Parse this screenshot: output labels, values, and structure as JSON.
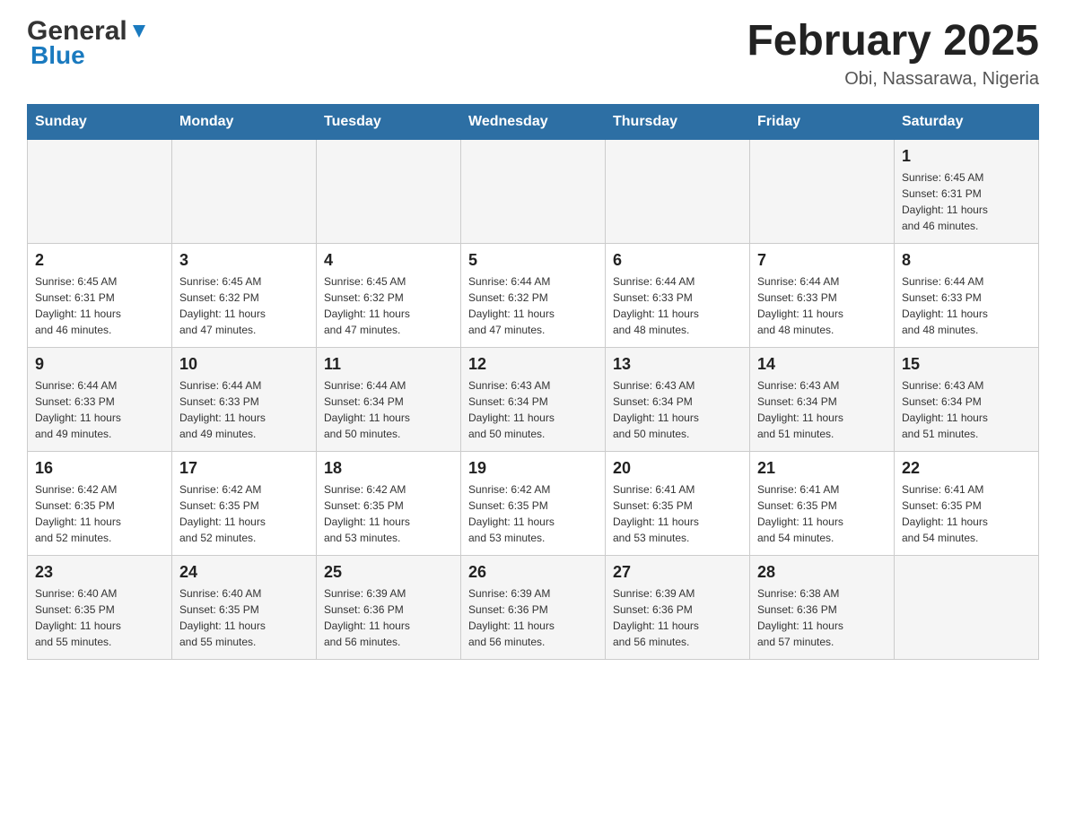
{
  "header": {
    "logo_general": "General",
    "logo_blue": "Blue",
    "title": "February 2025",
    "subtitle": "Obi, Nassarawa, Nigeria"
  },
  "weekdays": [
    "Sunday",
    "Monday",
    "Tuesday",
    "Wednesday",
    "Thursday",
    "Friday",
    "Saturday"
  ],
  "rows": [
    {
      "cells": [
        {
          "day": "",
          "info": ""
        },
        {
          "day": "",
          "info": ""
        },
        {
          "day": "",
          "info": ""
        },
        {
          "day": "",
          "info": ""
        },
        {
          "day": "",
          "info": ""
        },
        {
          "day": "",
          "info": ""
        },
        {
          "day": "1",
          "info": "Sunrise: 6:45 AM\nSunset: 6:31 PM\nDaylight: 11 hours\nand 46 minutes."
        }
      ]
    },
    {
      "cells": [
        {
          "day": "2",
          "info": "Sunrise: 6:45 AM\nSunset: 6:31 PM\nDaylight: 11 hours\nand 46 minutes."
        },
        {
          "day": "3",
          "info": "Sunrise: 6:45 AM\nSunset: 6:32 PM\nDaylight: 11 hours\nand 47 minutes."
        },
        {
          "day": "4",
          "info": "Sunrise: 6:45 AM\nSunset: 6:32 PM\nDaylight: 11 hours\nand 47 minutes."
        },
        {
          "day": "5",
          "info": "Sunrise: 6:44 AM\nSunset: 6:32 PM\nDaylight: 11 hours\nand 47 minutes."
        },
        {
          "day": "6",
          "info": "Sunrise: 6:44 AM\nSunset: 6:33 PM\nDaylight: 11 hours\nand 48 minutes."
        },
        {
          "day": "7",
          "info": "Sunrise: 6:44 AM\nSunset: 6:33 PM\nDaylight: 11 hours\nand 48 minutes."
        },
        {
          "day": "8",
          "info": "Sunrise: 6:44 AM\nSunset: 6:33 PM\nDaylight: 11 hours\nand 48 minutes."
        }
      ]
    },
    {
      "cells": [
        {
          "day": "9",
          "info": "Sunrise: 6:44 AM\nSunset: 6:33 PM\nDaylight: 11 hours\nand 49 minutes."
        },
        {
          "day": "10",
          "info": "Sunrise: 6:44 AM\nSunset: 6:33 PM\nDaylight: 11 hours\nand 49 minutes."
        },
        {
          "day": "11",
          "info": "Sunrise: 6:44 AM\nSunset: 6:34 PM\nDaylight: 11 hours\nand 50 minutes."
        },
        {
          "day": "12",
          "info": "Sunrise: 6:43 AM\nSunset: 6:34 PM\nDaylight: 11 hours\nand 50 minutes."
        },
        {
          "day": "13",
          "info": "Sunrise: 6:43 AM\nSunset: 6:34 PM\nDaylight: 11 hours\nand 50 minutes."
        },
        {
          "day": "14",
          "info": "Sunrise: 6:43 AM\nSunset: 6:34 PM\nDaylight: 11 hours\nand 51 minutes."
        },
        {
          "day": "15",
          "info": "Sunrise: 6:43 AM\nSunset: 6:34 PM\nDaylight: 11 hours\nand 51 minutes."
        }
      ]
    },
    {
      "cells": [
        {
          "day": "16",
          "info": "Sunrise: 6:42 AM\nSunset: 6:35 PM\nDaylight: 11 hours\nand 52 minutes."
        },
        {
          "day": "17",
          "info": "Sunrise: 6:42 AM\nSunset: 6:35 PM\nDaylight: 11 hours\nand 52 minutes."
        },
        {
          "day": "18",
          "info": "Sunrise: 6:42 AM\nSunset: 6:35 PM\nDaylight: 11 hours\nand 53 minutes."
        },
        {
          "day": "19",
          "info": "Sunrise: 6:42 AM\nSunset: 6:35 PM\nDaylight: 11 hours\nand 53 minutes."
        },
        {
          "day": "20",
          "info": "Sunrise: 6:41 AM\nSunset: 6:35 PM\nDaylight: 11 hours\nand 53 minutes."
        },
        {
          "day": "21",
          "info": "Sunrise: 6:41 AM\nSunset: 6:35 PM\nDaylight: 11 hours\nand 54 minutes."
        },
        {
          "day": "22",
          "info": "Sunrise: 6:41 AM\nSunset: 6:35 PM\nDaylight: 11 hours\nand 54 minutes."
        }
      ]
    },
    {
      "cells": [
        {
          "day": "23",
          "info": "Sunrise: 6:40 AM\nSunset: 6:35 PM\nDaylight: 11 hours\nand 55 minutes."
        },
        {
          "day": "24",
          "info": "Sunrise: 6:40 AM\nSunset: 6:35 PM\nDaylight: 11 hours\nand 55 minutes."
        },
        {
          "day": "25",
          "info": "Sunrise: 6:39 AM\nSunset: 6:36 PM\nDaylight: 11 hours\nand 56 minutes."
        },
        {
          "day": "26",
          "info": "Sunrise: 6:39 AM\nSunset: 6:36 PM\nDaylight: 11 hours\nand 56 minutes."
        },
        {
          "day": "27",
          "info": "Sunrise: 6:39 AM\nSunset: 6:36 PM\nDaylight: 11 hours\nand 56 minutes."
        },
        {
          "day": "28",
          "info": "Sunrise: 6:38 AM\nSunset: 6:36 PM\nDaylight: 11 hours\nand 57 minutes."
        },
        {
          "day": "",
          "info": ""
        }
      ]
    }
  ]
}
